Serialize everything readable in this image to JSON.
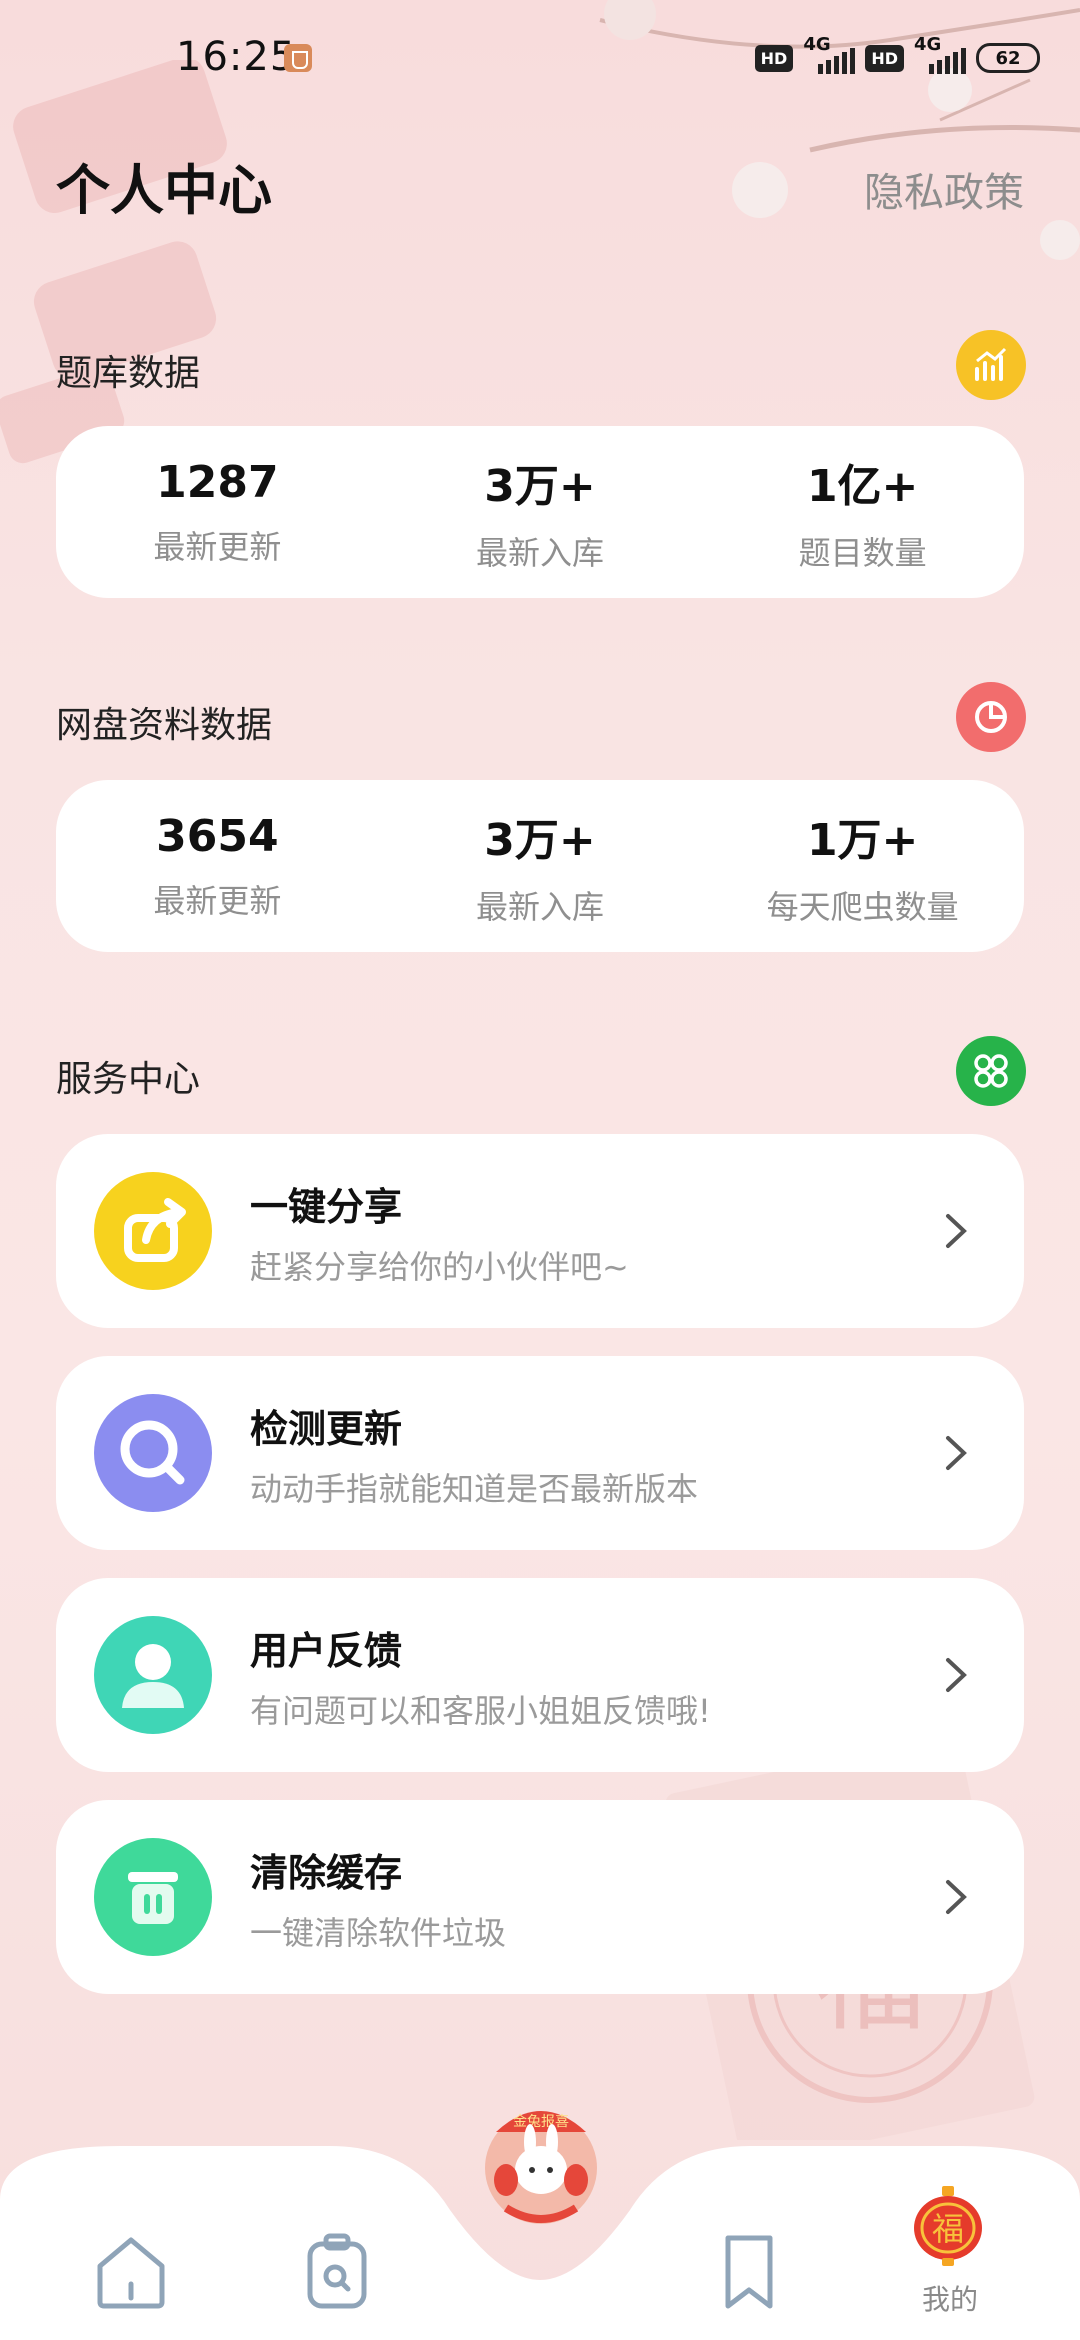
{
  "status_bar": {
    "time": "16:25",
    "hd1": "HD",
    "net1": "4G",
    "hd2": "HD",
    "net2": "4G",
    "battery": "62"
  },
  "header": {
    "title": "个人中心",
    "privacy_link": "隐私政策"
  },
  "question_bank": {
    "title": "题库数据",
    "icon": "chart-up-icon",
    "stats": [
      {
        "value": "1287",
        "label": "最新更新"
      },
      {
        "value": "3万+",
        "label": "最新入库"
      },
      {
        "value": "1亿+",
        "label": "题目数量"
      }
    ]
  },
  "netdisk": {
    "title": "网盘资料数据",
    "icon": "pie-chart-icon",
    "stats": [
      {
        "value": "3654",
        "label": "最新更新"
      },
      {
        "value": "3万+",
        "label": "最新入库"
      },
      {
        "value": "1万+",
        "label": "每天爬虫数量"
      }
    ]
  },
  "services": {
    "title": "服务中心",
    "icon": "grid-clover-icon",
    "items": [
      {
        "title": "一键分享",
        "desc": "赶紧分享给你的小伙伴吧~",
        "icon": "share-icon",
        "color": "#f7d21e"
      },
      {
        "title": "检测更新",
        "desc": "动动手指就能知道是否最新版本",
        "icon": "search-icon",
        "color": "#8b8df0"
      },
      {
        "title": "用户反馈",
        "desc": "有问题可以和客服小姐姐反馈哦!",
        "icon": "user-icon",
        "color": "#3fd6b6"
      },
      {
        "title": "清除缓存",
        "desc": "一键清除软件垃圾",
        "icon": "trash-icon",
        "color": "#3fd99a"
      }
    ]
  },
  "bottom_nav": {
    "items": [
      {
        "icon": "home-icon"
      },
      {
        "icon": "clipboard-search-icon"
      },
      {
        "icon": "mascot-icon"
      },
      {
        "icon": "bookmark-icon"
      },
      {
        "icon": "fu-lantern-icon",
        "label": "我的"
      }
    ],
    "active_color": "#8a8a8a"
  }
}
